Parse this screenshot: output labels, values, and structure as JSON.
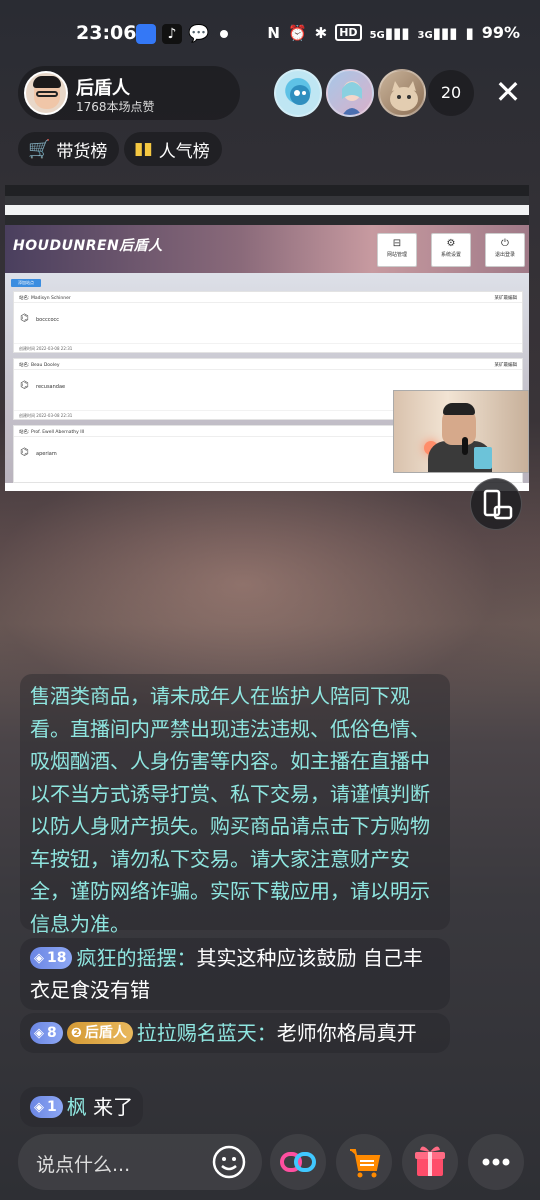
{
  "status_bar": {
    "time": "23:06",
    "network": "5G",
    "network2": "3G",
    "battery": "99%",
    "hd_label": "HD"
  },
  "host": {
    "name": "后盾人",
    "likes": "1768本场点赞"
  },
  "viewers": {
    "count": "20"
  },
  "chips": {
    "goods_rank": "带货榜",
    "popularity_rank": "人气榜"
  },
  "screen": {
    "logo": "HOUDUNREN后盾人",
    "buttons": [
      "网站管理",
      "系统设置",
      "退出登录"
    ],
    "add_button": "添加站点",
    "cards": [
      {
        "title": "站名: Madisyn Schinner",
        "right": "某矿最编辑",
        "text": "bocccocc",
        "date": "创建时间 2022-03-08 22:31"
      },
      {
        "title": "站名: Beau Dooley",
        "right": "某矿最编辑",
        "text": "recusandae",
        "date": "创建时间 2022-03-08 22:31"
      },
      {
        "title": "站名: Prof. Ewell Abernathy III",
        "right": "",
        "text": "aperiam",
        "date": ""
      }
    ]
  },
  "notice": {
    "text": "售酒类商品，请未成年人在监护人陪同下观看。直播间内严禁出现违法违规、低俗色情、吸烟酗酒、人身伤害等内容。如主播在直播中以不当方式诱导打赏、私下交易，请谨慎判断以防人身财产损失。购买商品请点击下方购物车按钮，请勿私下交易。请大家注意财产安全，谨防网络诈骗。实际下载应用，请以明示信息为准。"
  },
  "comments": [
    {
      "level": "18",
      "user": "疯狂的摇摆：",
      "text": "其实这种应该鼓励 自己丰衣足食没有错"
    },
    {
      "level": "8",
      "fan_level": "2",
      "fan_name": "后盾人",
      "user": "拉拉赐名蓝天：",
      "text": "老师你格局真开"
    },
    {
      "level": "1",
      "user": "枫",
      "text": " 来了"
    }
  ],
  "input": {
    "placeholder": "说点什么..."
  },
  "colors": {
    "accent_cyan": "#8fe6e0",
    "level_badge": "#7b95ea",
    "fan_badge": "#e0a948",
    "cart_orange": "#ff8a00",
    "gift_red": "#ff4d6a"
  }
}
